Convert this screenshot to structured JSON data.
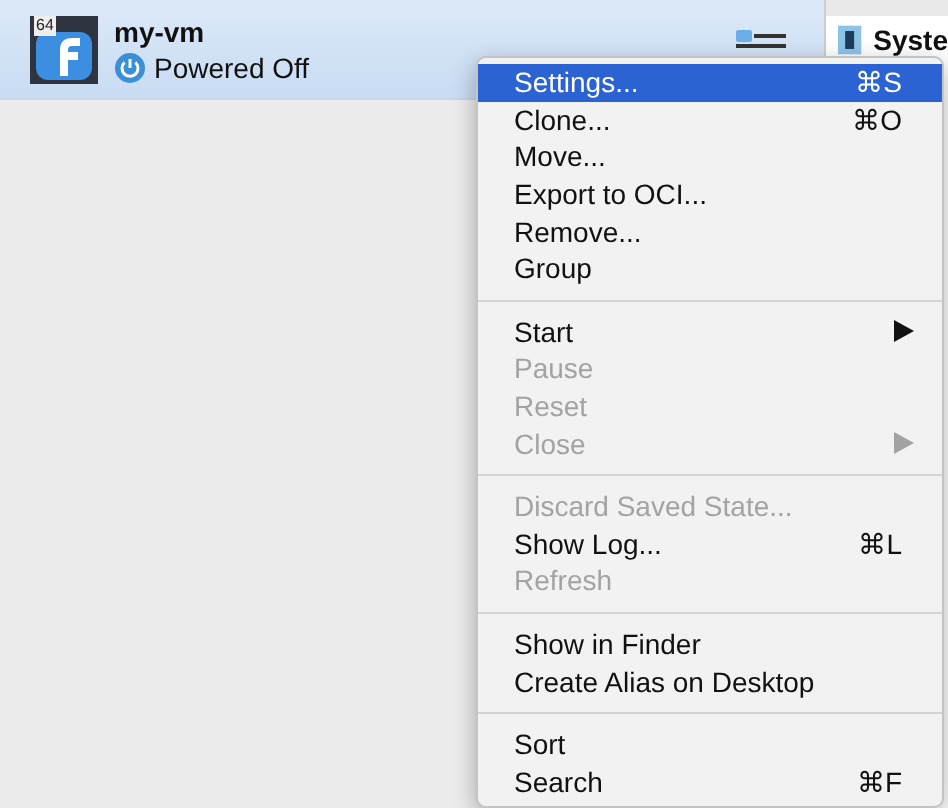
{
  "vm": {
    "badge": "64",
    "name": "my-vm",
    "state": "Powered Off",
    "selected": true
  },
  "details": {
    "heading": "Syste"
  },
  "menu": {
    "groups": [
      [
        {
          "label": "Settings...",
          "shortcut": "⌘S",
          "submenu": false,
          "disabled": false,
          "selected": true
        },
        {
          "label": "Clone...",
          "shortcut": "⌘O",
          "submenu": false,
          "disabled": false,
          "selected": false
        },
        {
          "label": "Move...",
          "submenu": false,
          "disabled": false,
          "selected": false
        },
        {
          "label": "Export to OCI...",
          "submenu": false,
          "disabled": false,
          "selected": false
        },
        {
          "label": "Remove...",
          "submenu": false,
          "disabled": false,
          "selected": false
        },
        {
          "label": "Group",
          "submenu": false,
          "disabled": false,
          "selected": false
        }
      ],
      [
        {
          "label": "Start",
          "submenu": true,
          "disabled": false,
          "selected": false
        },
        {
          "label": "Pause",
          "submenu": false,
          "disabled": true,
          "selected": false
        },
        {
          "label": "Reset",
          "submenu": false,
          "disabled": true,
          "selected": false
        },
        {
          "label": "Close",
          "submenu": true,
          "disabled": true,
          "selected": false
        }
      ],
      [
        {
          "label": "Discard Saved State...",
          "submenu": false,
          "disabled": true,
          "selected": false
        },
        {
          "label": "Show Log...",
          "shortcut": "⌘L",
          "submenu": false,
          "disabled": false,
          "selected": false
        },
        {
          "label": "Refresh",
          "submenu": false,
          "disabled": true,
          "selected": false
        }
      ],
      [
        {
          "label": "Show in Finder",
          "submenu": false,
          "disabled": false,
          "selected": false
        },
        {
          "label": "Create Alias on Desktop",
          "submenu": false,
          "disabled": false,
          "selected": false
        }
      ],
      [
        {
          "label": "Sort",
          "submenu": false,
          "disabled": false,
          "selected": false
        },
        {
          "label": "Search",
          "shortcut": "⌘F",
          "submenu": false,
          "disabled": false,
          "selected": false
        }
      ]
    ]
  }
}
